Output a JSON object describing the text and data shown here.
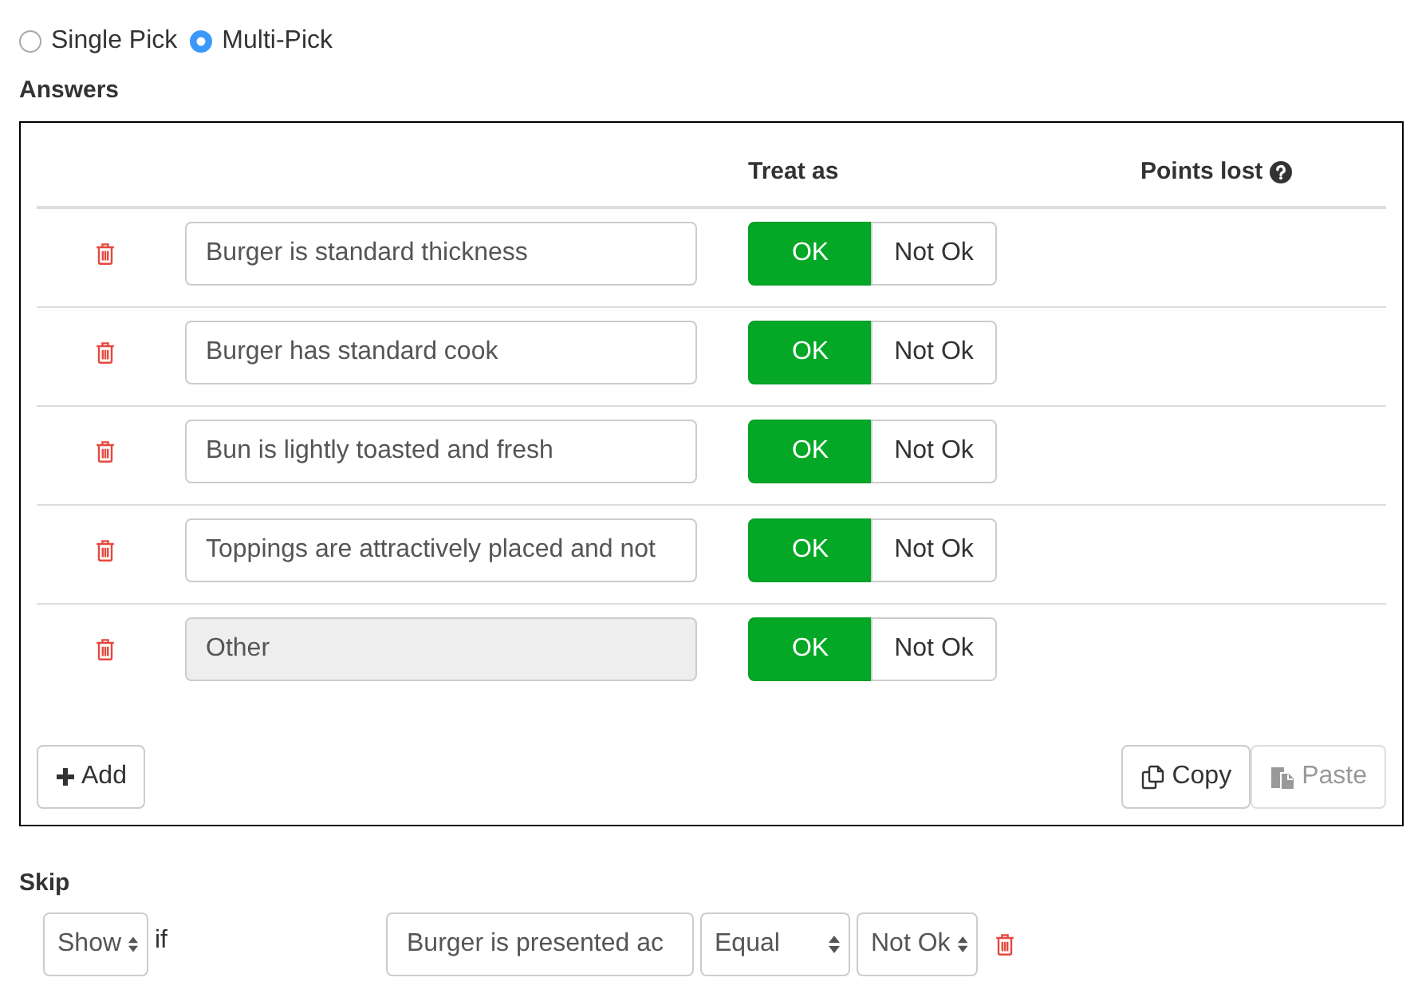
{
  "mode_options": [
    {
      "label": "Single Pick",
      "selected": false
    },
    {
      "label": "Multi-Pick",
      "selected": true
    }
  ],
  "answers": {
    "title": "Answers",
    "columns": {
      "treat_as": "Treat as",
      "points_lost": "Points lost"
    },
    "rows": [
      {
        "text": "Burger is standard thickness",
        "disabled": false,
        "treat_as": [
          {
            "label": "OK",
            "selected": true
          },
          {
            "label": "Not Ok",
            "selected": false
          }
        ]
      },
      {
        "text": "Burger has standard cook",
        "disabled": false,
        "treat_as": [
          {
            "label": "OK",
            "selected": true
          },
          {
            "label": "Not Ok",
            "selected": false
          }
        ]
      },
      {
        "text": "Bun is lightly toasted and fresh",
        "disabled": false,
        "treat_as": [
          {
            "label": "OK",
            "selected": true
          },
          {
            "label": "Not Ok",
            "selected": false
          }
        ]
      },
      {
        "text": "Toppings are attractively placed and not",
        "disabled": false,
        "treat_as": [
          {
            "label": "OK",
            "selected": true
          },
          {
            "label": "Not Ok",
            "selected": false
          }
        ]
      },
      {
        "text": "Other",
        "disabled": true,
        "treat_as": [
          {
            "label": "OK",
            "selected": true
          },
          {
            "label": "Not Ok",
            "selected": false
          }
        ]
      }
    ],
    "add_button": {
      "label": "Add"
    },
    "copy_button": {
      "label": "Copy",
      "disabled": false
    },
    "paste_button": {
      "label": "Paste",
      "disabled": true
    }
  },
  "skip": {
    "title": "Skip",
    "action": "Show",
    "condition_word": "if",
    "question": "Burger is presented ac",
    "operator": "Equal",
    "answer": "Not Ok"
  }
}
